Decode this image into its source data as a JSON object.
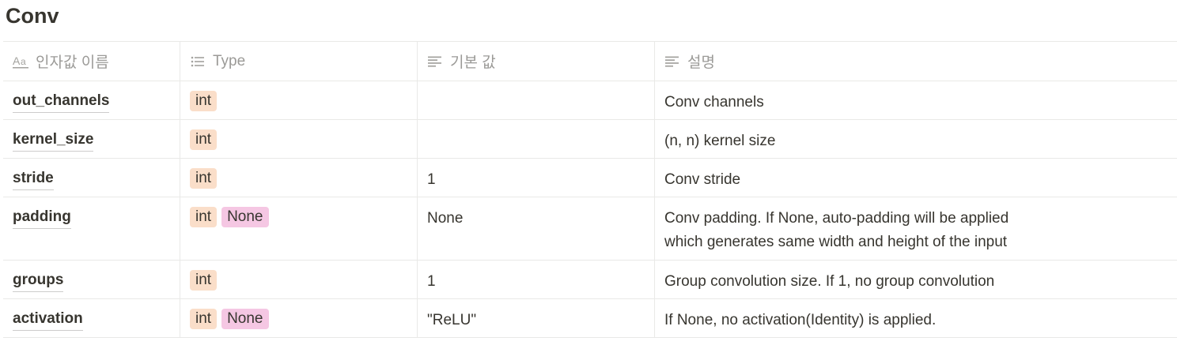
{
  "title": "Conv",
  "columns": [
    {
      "label": "인자값 이름",
      "icon": "title-aa-icon"
    },
    {
      "label": "Type",
      "icon": "multi-select-list-icon"
    },
    {
      "label": "기본 값",
      "icon": "text-lines-icon"
    },
    {
      "label": "설명",
      "icon": "text-lines-icon"
    }
  ],
  "rows": [
    {
      "name": "out_channels",
      "types": [
        "int"
      ],
      "default": "",
      "desc": "Conv channels"
    },
    {
      "name": "kernel_size",
      "types": [
        "int"
      ],
      "default": "",
      "desc": "(n, n) kernel size"
    },
    {
      "name": "stride",
      "types": [
        "int"
      ],
      "default": "1",
      "desc": "Conv stride"
    },
    {
      "name": "padding",
      "types": [
        "int",
        "None"
      ],
      "default": "None",
      "desc": "Conv padding. If None, auto-padding will be applied\nwhich generates same width and height of the input"
    },
    {
      "name": "groups",
      "types": [
        "int"
      ],
      "default": "1",
      "desc": "Group convolution size. If 1, no group convolution"
    },
    {
      "name": "activation",
      "types": [
        "int",
        "None"
      ],
      "default": "\"ReLU\"",
      "desc": "If None, no activation(Identity) is applied."
    }
  ],
  "tag_colors": {
    "int": "#fadec9",
    "None": "#f5c7e3"
  }
}
